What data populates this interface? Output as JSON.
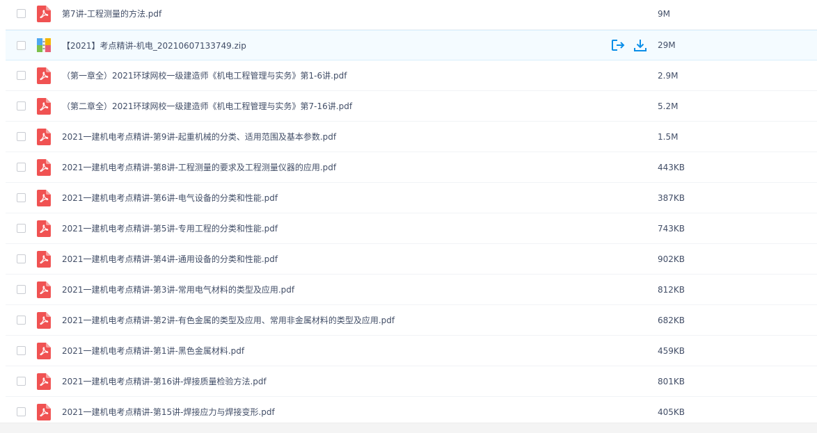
{
  "files": [
    {
      "name": "第7讲-工程测量的方法.pdf",
      "size": "9M",
      "type": "pdf-icon"
    },
    {
      "name": "【2021】考点精讲-机电_20210607133749.zip",
      "size": "29M",
      "type": "zip-icon",
      "hover": true
    },
    {
      "name": "（第一章全）2021环球网校一级建造师《机电工程管理与实务》第1-6讲.pdf",
      "size": "2.9M",
      "type": "pdf-icon"
    },
    {
      "name": "（第二章全）2021环球网校一级建造师《机电工程管理与实务》第7-16讲.pdf",
      "size": "5.2M",
      "type": "pdf-icon"
    },
    {
      "name": "2021一建机电考点精讲-第9讲-起重机械的分类、适用范围及基本参数.pdf",
      "size": "1.5M",
      "type": "pdf-icon"
    },
    {
      "name": "2021一建机电考点精讲-第8讲-工程测量的要求及工程测量仪器的应用.pdf",
      "size": "443KB",
      "type": "pdf-icon"
    },
    {
      "name": "2021一建机电考点精讲-第6讲-电气设备的分类和性能.pdf",
      "size": "387KB",
      "type": "pdf-icon"
    },
    {
      "name": "2021一建机电考点精讲-第5讲-专用工程的分类和性能.pdf",
      "size": "743KB",
      "type": "pdf-icon"
    },
    {
      "name": "2021一建机电考点精讲-第4讲-通用设备的分类和性能.pdf",
      "size": "902KB",
      "type": "pdf-icon"
    },
    {
      "name": "2021一建机电考点精讲-第3讲-常用电气材料的类型及应用.pdf",
      "size": "812KB",
      "type": "pdf-icon"
    },
    {
      "name": "2021一建机电考点精讲-第2讲-有色金属的类型及应用、常用非金属材料的类型及应用.pdf",
      "size": "682KB",
      "type": "pdf-icon"
    },
    {
      "name": "2021一建机电考点精讲-第1讲-黑色金属材料.pdf",
      "size": "459KB",
      "type": "pdf-icon"
    },
    {
      "name": "2021一建机电考点精讲-第16讲-焊接质量检验方法.pdf",
      "size": "801KB",
      "type": "pdf-icon"
    },
    {
      "name": "2021一建机电考点精讲-第15讲-焊接应力与焊接变形.pdf",
      "size": "405KB",
      "type": "pdf-icon"
    }
  ],
  "actions": {
    "share_icon": "share-icon",
    "download_icon": "download-icon"
  },
  "colors": {
    "accent": "#0a8ee8",
    "pdf": "#f05252",
    "text": "#424e67",
    "hover_bg": "#f4fbff"
  }
}
